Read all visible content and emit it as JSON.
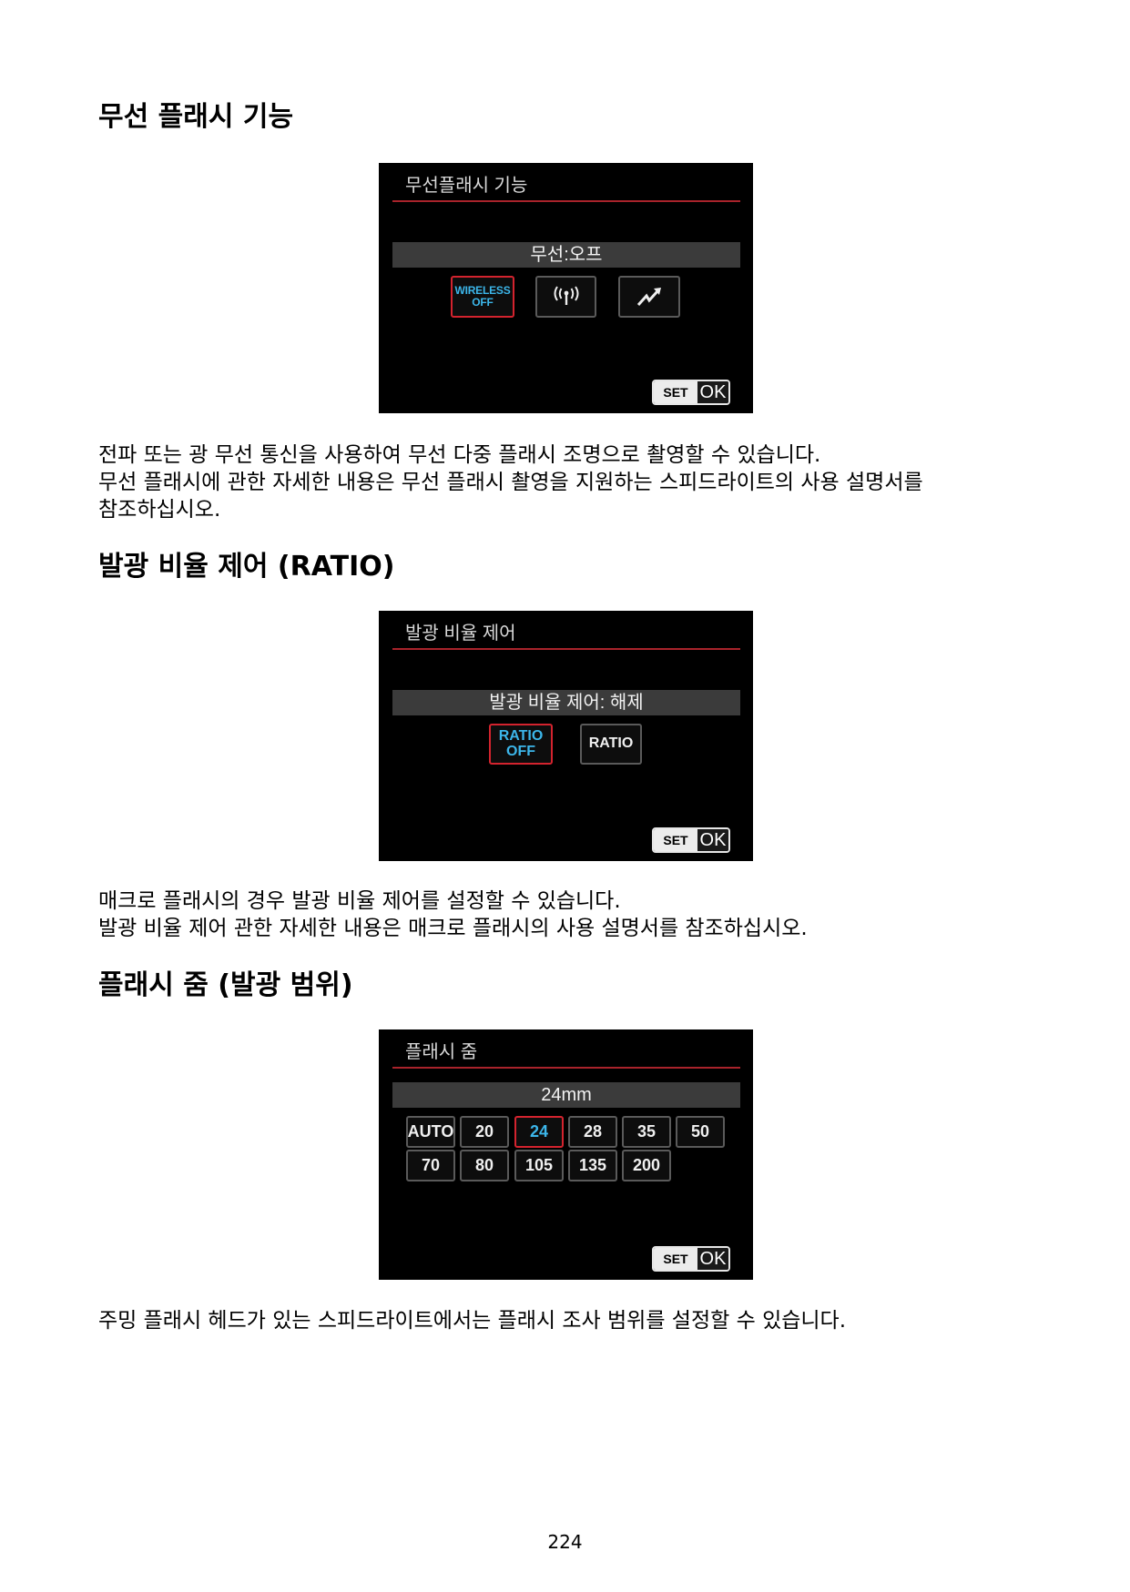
{
  "sections": [
    {
      "heading": "무선 플래시 기능",
      "screen": {
        "title": "무선플래시 기능",
        "status": "무선:오프",
        "options": [
          {
            "label_lines": [
              "WIRELESS",
              "OFF"
            ],
            "selected": true
          },
          {
            "icon": "radio-wave-icon",
            "selected": false
          },
          {
            "icon": "lightning-icon",
            "selected": false
          }
        ],
        "set_label": "SET",
        "ok_label": "OK"
      },
      "lines": [
        "전파 또는 광 무선 통신을 사용하여 무선 다중 플래시 조명으로 촬영할 수 있습니다.",
        "무선 플래시에 관한 자세한 내용은 무선 플래시 촬영을 지원하는 스피드라이트의 사용 설명서를",
        "참조하십시오."
      ]
    },
    {
      "heading": "발광 비율 제어 (RATIO)",
      "screen": {
        "title": "발광 비율 제어",
        "status": "발광 비율 제어: 해제",
        "options": [
          {
            "label_lines": [
              "RATIO",
              "OFF"
            ],
            "selected": true
          },
          {
            "label_lines": [
              "RATIO"
            ],
            "selected": false
          }
        ],
        "set_label": "SET",
        "ok_label": "OK"
      },
      "lines": [
        "매크로 플래시의 경우 발광 비율 제어를 설정할 수 있습니다.",
        "발광 비율 제어 관한 자세한 내용은 매크로 플래시의 사용 설명서를 참조하십시오."
      ]
    },
    {
      "heading": "플래시 줌 (발광 범위)",
      "screen": {
        "title": "플래시 줌",
        "status": "24mm",
        "zoom_rows": [
          [
            "AUTO",
            "20",
            "24",
            "28",
            "35",
            "50"
          ],
          [
            "70",
            "80",
            "105",
            "135",
            "200"
          ]
        ],
        "selected": "24",
        "set_label": "SET",
        "ok_label": "OK"
      },
      "lines": [
        "주밍 플래시 헤드가 있는 스피드라이트에서는 플래시 조사 범위를 설정할 수 있습니다."
      ]
    }
  ],
  "page_number": "224",
  "colors": {
    "screen_bg": "#000000",
    "menu_rule": "#a8232b",
    "status_bar": "#3b3b3b",
    "selected_border": "#d3232e",
    "selected_text": "#3cb6ea"
  }
}
